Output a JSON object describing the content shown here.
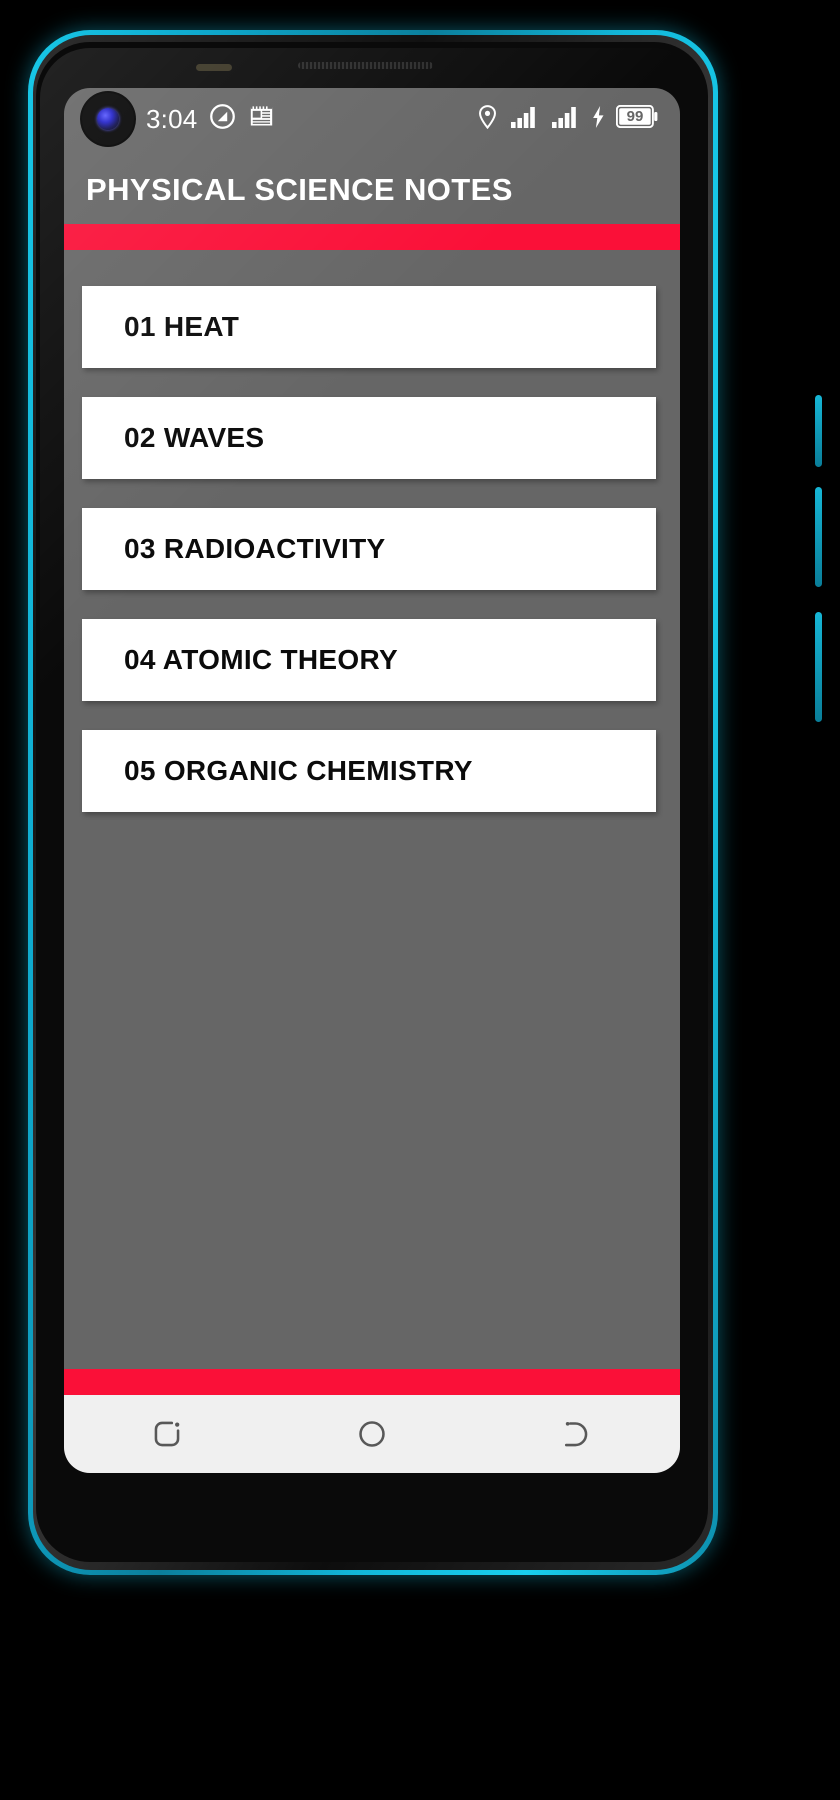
{
  "device": {
    "frame_color": "#12b6d8",
    "screen_bg": "#666666"
  },
  "status_bar": {
    "time": "3:04",
    "left_icons": [
      {
        "name": "punch-hole-camera",
        "glyph": "camera"
      },
      {
        "name": "do-not-disturb-icon",
        "glyph": "circle-slash"
      },
      {
        "name": "news-widget-icon",
        "glyph": "news"
      }
    ],
    "right_icons": [
      {
        "name": "location-icon",
        "glyph": "pin"
      },
      {
        "name": "signal-sim1-icon",
        "glyph": "bars"
      },
      {
        "name": "signal-sim2-icon",
        "glyph": "bars"
      },
      {
        "name": "charging-icon",
        "glyph": "bolt"
      }
    ],
    "battery_level": "99"
  },
  "app_bar": {
    "title": "PHYSICAL SCIENCE NOTES",
    "accent_color": "#FA1038"
  },
  "chapters": [
    {
      "label": "01 HEAT"
    },
    {
      "label": "02 WAVES"
    },
    {
      "label": "03 RADIOACTIVITY"
    },
    {
      "label": "04 ATOMIC THEORY"
    },
    {
      "label": "05 ORGANIC CHEMISTRY"
    }
  ],
  "nav_bar": {
    "buttons": [
      {
        "name": "recents-button",
        "label": "Recents"
      },
      {
        "name": "home-button",
        "label": "Home"
      },
      {
        "name": "back-button",
        "label": "Back"
      }
    ]
  }
}
